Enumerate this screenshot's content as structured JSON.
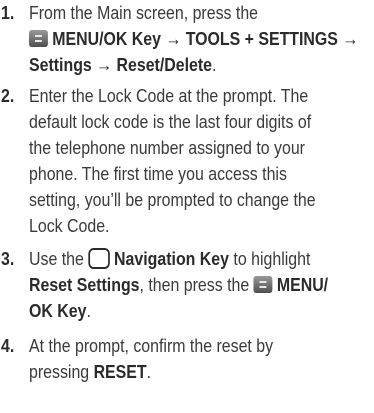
{
  "steps": [
    {
      "number": "1.",
      "lines": [
        {
          "t1": "From the Main screen, press the"
        },
        {
          "b1": "MENU/OK Key → TOOLS + SETTINGS →"
        },
        {
          "b1": "Settings",
          "t1": " → ",
          "b2": "Reset/Delete",
          "t2": "."
        }
      ]
    },
    {
      "number": "2.",
      "lines": [
        {
          "t1": "Enter the Lock Code at the prompt. The"
        },
        {
          "t1": "default lock code is the last four digits of"
        },
        {
          "t1": "the telephone number assigned to your"
        },
        {
          "t1": "phone. The first time you access this"
        },
        {
          "t1": "setting, you’ll be prompted to change the"
        },
        {
          "t1": "Lock Code."
        }
      ]
    },
    {
      "number": "3.",
      "lines": [
        {
          "t1": "Use the ",
          "b1": "Navigation Key",
          "t2": " to highlight"
        },
        {
          "b1": "Reset Settings",
          "t1": ", then press the ",
          "b2": "MENU/"
        },
        {
          "b1": "OK Key",
          "t1": "."
        }
      ]
    },
    {
      "number": "4.",
      "lines": [
        {
          "t1": "At the prompt, confirm the reset by"
        },
        {
          "t1": "pressing ",
          "b1": "RESET",
          "t2": "."
        }
      ]
    }
  ],
  "icons": {
    "menu_ok_key": "menu-ok-key-icon",
    "navigation_key": "navigation-key-icon"
  }
}
